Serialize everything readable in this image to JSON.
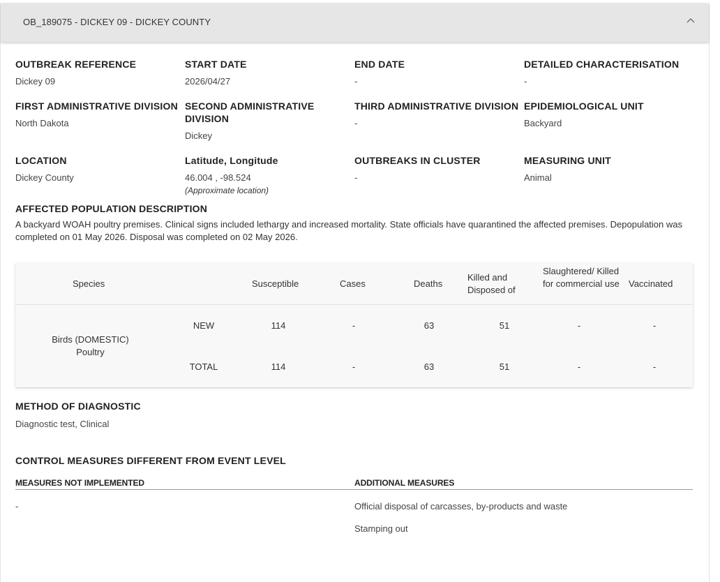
{
  "header": {
    "title": "OB_189075 - DICKEY 09 - DICKEY COUNTY"
  },
  "fields": {
    "outbreak_reference": {
      "label": "OUTBREAK REFERENCE",
      "value": "Dickey 09"
    },
    "start_date": {
      "label": "START DATE",
      "value": "2026/04/27"
    },
    "end_date": {
      "label": "END DATE",
      "value": "-"
    },
    "detailed_characterisation": {
      "label": "DETAILED CHARACTERISATION",
      "value": "-"
    },
    "first_admin": {
      "label": "FIRST ADMINISTRATIVE DIVISION",
      "value": "North Dakota"
    },
    "second_admin": {
      "label": "SECOND ADMINISTRATIVE DIVISION",
      "value": "Dickey"
    },
    "third_admin": {
      "label": "THIRD ADMINISTRATIVE DIVISION",
      "value": "-"
    },
    "epi_unit": {
      "label": "EPIDEMIOLOGICAL UNIT",
      "value": "Backyard"
    },
    "location": {
      "label": "LOCATION",
      "value": "Dickey County"
    },
    "lat_long": {
      "label": "Latitude, Longitude",
      "value": "46.004 , -98.524",
      "note": "(Approximate location)"
    },
    "outbreaks_in_cluster": {
      "label": "OUTBREAKS IN CLUSTER",
      "value": "-"
    },
    "measuring_unit": {
      "label": "MEASURING UNIT",
      "value": "Animal"
    }
  },
  "affected_population": {
    "label": "AFFECTED POPULATION DESCRIPTION",
    "text": "A backyard WOAH poultry premises. Clinical signs included lethargy and increased mortality. State officials have quarantined the affected premises. Depopulation was completed on 01 May 2026. Disposal was completed on 02 May 2026."
  },
  "table": {
    "headers": {
      "species": "Species",
      "susceptible": "Susceptible",
      "cases": "Cases",
      "deaths": "Deaths",
      "killed": "Killed and Disposed of",
      "slaughtered": "Slaughtered/ Killed for commercial use",
      "vaccinated": "Vaccinated"
    },
    "species_line1": "Birds (DOMESTIC)",
    "species_line2": "Poultry",
    "rows": [
      {
        "type": "NEW",
        "susceptible": "114",
        "cases": "-",
        "deaths": "63",
        "killed": "51",
        "slaughtered": "-",
        "vaccinated": "-"
      },
      {
        "type": "TOTAL",
        "susceptible": "114",
        "cases": "-",
        "deaths": "63",
        "killed": "51",
        "slaughtered": "-",
        "vaccinated": "-"
      }
    ]
  },
  "diagnostic": {
    "label": "METHOD OF DIAGNOSTIC",
    "value": "Diagnostic test, Clinical"
  },
  "control_measures": {
    "label": "CONTROL MEASURES DIFFERENT FROM EVENT LEVEL",
    "not_implemented_label": "MEASURES NOT IMPLEMENTED",
    "not_implemented_value": "-",
    "additional_label": "ADDITIONAL MEASURES",
    "additional_items": [
      "Official disposal of carcasses, by-products and waste",
      "Stamping out"
    ]
  }
}
